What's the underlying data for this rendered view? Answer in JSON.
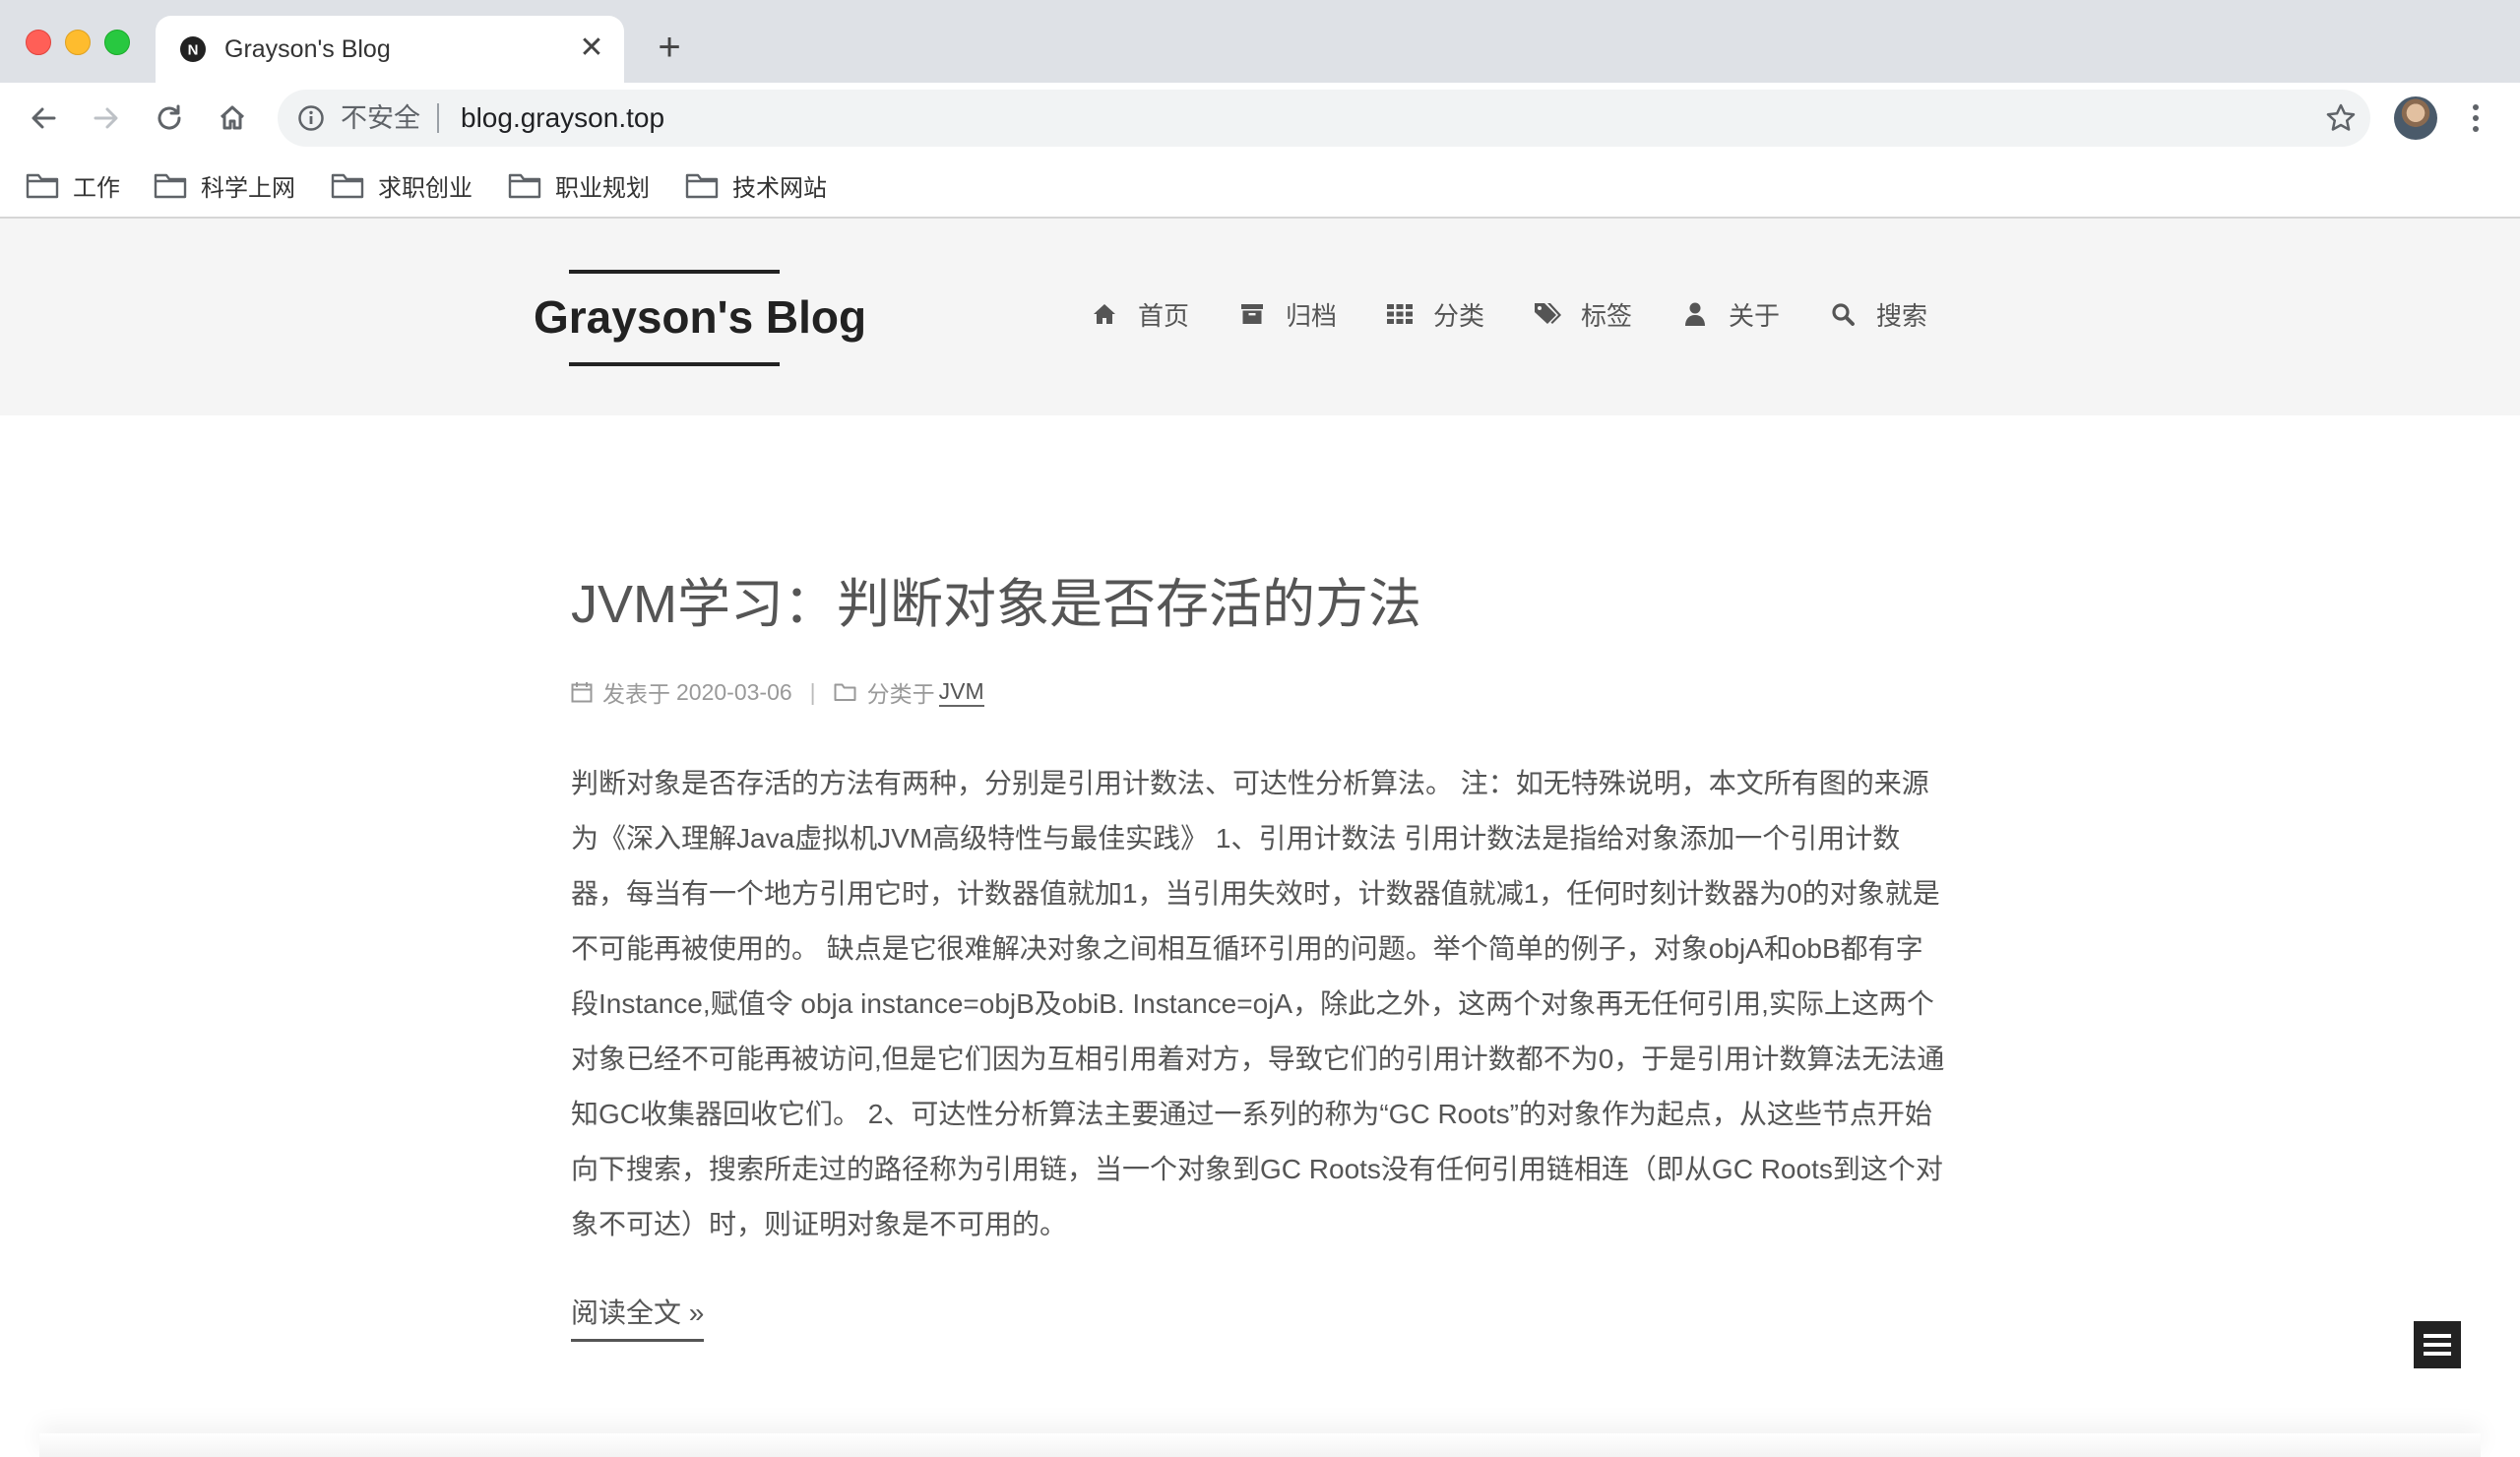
{
  "browser": {
    "tab": {
      "title": "Grayson's Blog",
      "favicon_letter": "N"
    },
    "address": {
      "security_label": "不安全",
      "url": "blog.grayson.top"
    },
    "bookmarks": [
      {
        "label": "工作",
        "icon": "folder-icon"
      },
      {
        "label": "科学上网",
        "icon": "folder-icon"
      },
      {
        "label": "求职创业",
        "icon": "folder-icon"
      },
      {
        "label": "职业规划",
        "icon": "folder-icon"
      },
      {
        "label": "技术网站",
        "icon": "folder-icon"
      }
    ]
  },
  "site": {
    "brand": "Grayson's Blog",
    "menu": [
      {
        "label": "首页",
        "icon": "home-icon"
      },
      {
        "label": "归档",
        "icon": "archive-icon"
      },
      {
        "label": "分类",
        "icon": "grid-icon"
      },
      {
        "label": "标签",
        "icon": "tags-icon"
      },
      {
        "label": "关于",
        "icon": "user-icon"
      },
      {
        "label": "搜索",
        "icon": "search-icon"
      }
    ]
  },
  "post": {
    "title": "JVM学习：判断对象是否存活的方法",
    "meta": {
      "posted_label": "发表于",
      "date": "2020-03-06",
      "divider": "|",
      "category_label": "分类于",
      "category": "JVM"
    },
    "excerpt": "判断对象是否存活的方法有两种，分别是引用计数法、可达性分析算法。 注：如无特殊说明，本文所有图的来源为《深入理解Java虚拟机JVM高级特性与最佳实践》 1、引用计数法 引用计数法是指给对象添加一个引用计数器，每当有一个地方引用它时，计数器值就加1，当引用失效时，计数器值就减1，任何时刻计数器为0的对象就是不可能再被使用的。 缺点是它很难解决对象之间相互循环引用的问题。举个简单的例子，对象objA和obB都有字段Instance,赋值令 obja instance=objB及obiB. Instance=ojA，除此之外，这两个对象再无任何引用,实际上这两个对象已经不可能再被访问,但是它们因为互相引用着对方，导致它们的引用计数都不为0，于是引用计数算法无法通知GC收集器回收它们。 2、可达性分析算法主要通过一系列的称为“GC Roots”的对象作为起点，从这些节点开始向下搜索，搜索所走过的路径称为引用链，当一个对象到GC Roots没有任何引用链相连（即从GC Roots到这个对象不可达）时，则证明对象是不可用的。",
    "read_more": "阅读全文 »"
  },
  "colors": {
    "tabbar_bg": "#dee1e6",
    "header_bg": "#f5f5f5",
    "text": "#555555",
    "brand": "#222222"
  }
}
